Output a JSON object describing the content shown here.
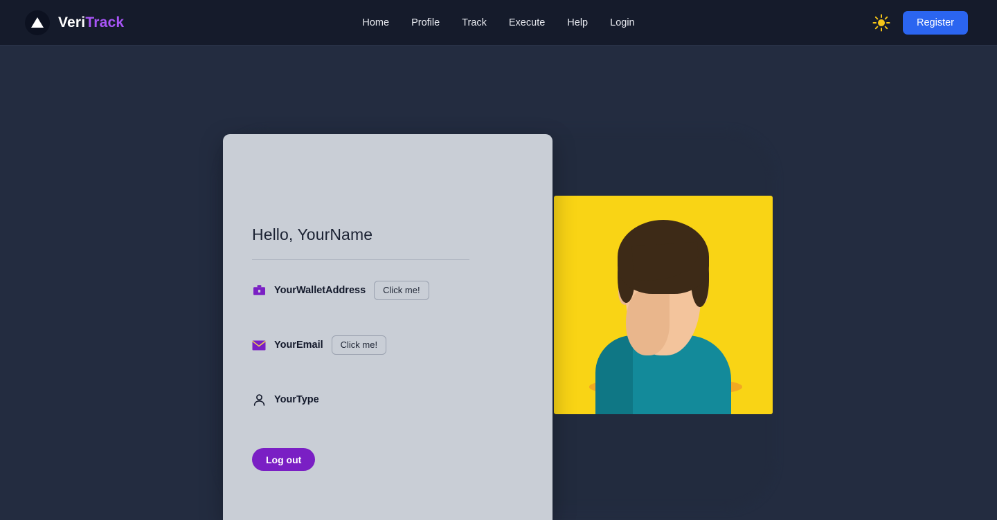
{
  "header": {
    "brand": {
      "part1": "Veri",
      "part2": "Track",
      "logo_icon": "triangle-logo-icon"
    },
    "nav": [
      {
        "label": "Home",
        "name": "nav-link-home"
      },
      {
        "label": "Profile",
        "name": "nav-link-profile"
      },
      {
        "label": "Track",
        "name": "nav-link-track"
      },
      {
        "label": "Execute",
        "name": "nav-link-execute"
      },
      {
        "label": "Help",
        "name": "nav-link-help"
      },
      {
        "label": "Login",
        "name": "nav-link-login"
      }
    ],
    "theme_toggle_icon": "sun-icon",
    "register_label": "Register",
    "colors": {
      "header_bg": "#151b2b",
      "page_bg": "#232c40",
      "brand_accent": "#a855f7",
      "register_bg": "#2b65f0",
      "sun": "#f5c518"
    }
  },
  "profile_card": {
    "greeting": "Hello, YourName",
    "rows": [
      {
        "icon": "briefcase-icon",
        "label": "YourWalletAddress",
        "action_label": "Click me!",
        "has_action": true
      },
      {
        "icon": "envelope-icon",
        "label": "YourEmail",
        "action_label": "Click me!",
        "has_action": true
      },
      {
        "icon": "person-icon",
        "label": "YourType",
        "action_label": "",
        "has_action": false
      }
    ],
    "logout_label": "Log out",
    "colors": {
      "card_bg": "#c9ced6",
      "icon_purple": "#7a1fc4",
      "logout_bg": "#7a1fc4"
    }
  },
  "avatar": {
    "name": "profile-avatar-illustration",
    "colors": {
      "background": "#f9d415",
      "hair": "#3d2a17",
      "skin": "#f3c49c",
      "skin_shade": "#e9b68c",
      "shirt": "#ffffff",
      "sweater": "#138a9a",
      "shadow": "#f2a922"
    }
  }
}
